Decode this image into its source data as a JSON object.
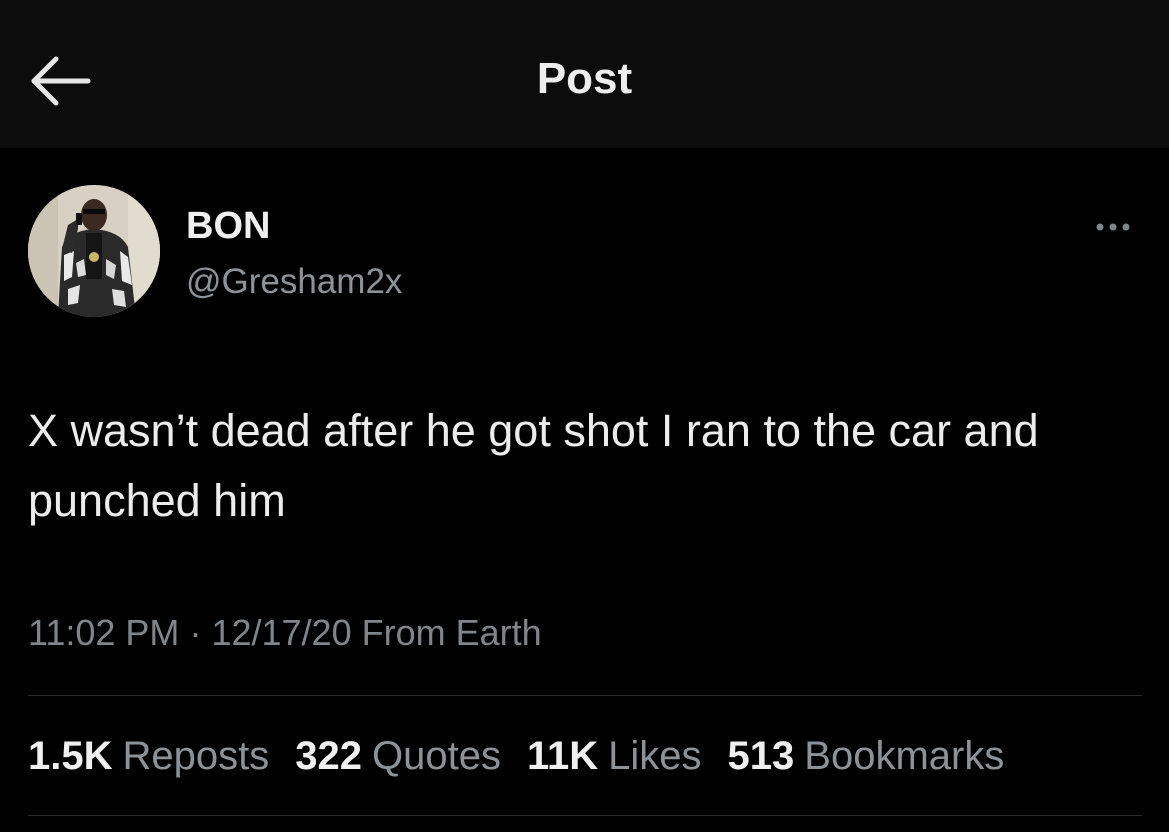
{
  "header": {
    "title": "Post",
    "back_icon": "arrow-left-icon"
  },
  "author": {
    "display_name": "BON",
    "handle": "@Gresham2x",
    "avatar": "profile-photo"
  },
  "menu": {
    "icon": "more-horizontal-icon"
  },
  "tweet": {
    "text": "X wasn’t dead after he got shot I ran to the car and punched him",
    "time": "11:02 PM",
    "separator": "·",
    "date": "12/17/20",
    "source": "From Earth"
  },
  "stats": [
    {
      "count": "1.5K",
      "label": "Reposts"
    },
    {
      "count": "322",
      "label": "Quotes"
    },
    {
      "count": "11K",
      "label": "Likes"
    },
    {
      "count": "513",
      "label": "Bookmarks"
    }
  ],
  "colors": {
    "background": "#000000",
    "header_background": "#0c0c0c",
    "primary_text": "#e7e9ea",
    "secondary_text": "#8b9298",
    "divider": "#2a2d30"
  }
}
